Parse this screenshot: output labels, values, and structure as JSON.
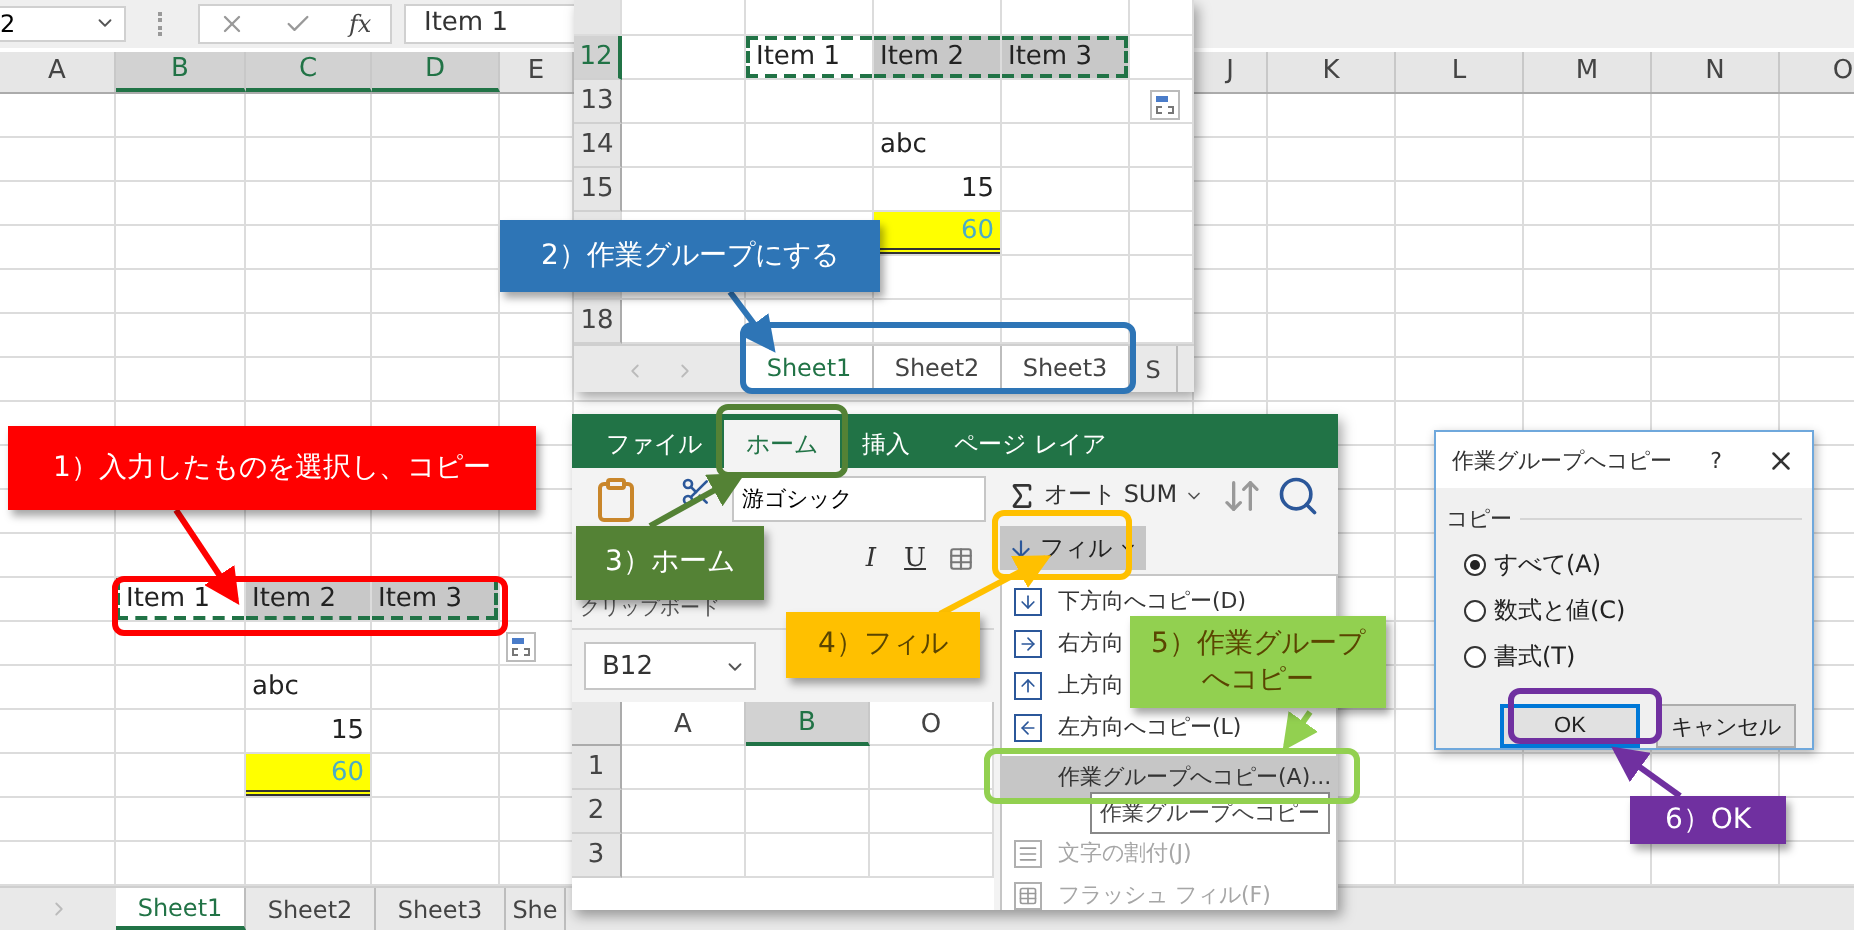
{
  "formula_bar": {
    "name_box": "2",
    "function_label": "fx",
    "formula": "Item 1"
  },
  "sheet": {
    "columns": [
      {
        "label": "A",
        "selected": false
      },
      {
        "label": "B",
        "selected": true
      },
      {
        "label": "C",
        "selected": true
      },
      {
        "label": "D",
        "selected": true
      },
      {
        "label": "E",
        "selected": false
      },
      {
        "label": "J",
        "selected": false
      },
      {
        "label": "K",
        "selected": false
      },
      {
        "label": "L",
        "selected": false
      },
      {
        "label": "M",
        "selected": false
      },
      {
        "label": "N",
        "selected": false
      },
      {
        "label": "O",
        "selected": false
      }
    ],
    "selection": [
      "Item 1",
      "Item 2",
      "Item 3"
    ],
    "values": [
      {
        "kind": "text",
        "text": "abc"
      },
      {
        "kind": "number",
        "text": "15"
      },
      {
        "kind": "highlight",
        "text": "60"
      }
    ],
    "tabs": [
      {
        "label": "Sheet1",
        "selected": true
      },
      {
        "label": "Sheet2",
        "selected": false
      },
      {
        "label": "Sheet3",
        "selected": false
      },
      {
        "label": "She",
        "selected": false
      }
    ]
  },
  "group_sheet": {
    "rows": [
      {
        "label": "12",
        "selected": true
      },
      {
        "label": "13",
        "selected": false
      },
      {
        "label": "14",
        "selected": false
      },
      {
        "label": "15",
        "selected": false
      },
      {
        "label": "18",
        "selected": false
      }
    ],
    "selection": [
      "Item 1",
      "Item 2",
      "Item 3"
    ],
    "values": [
      {
        "kind": "text",
        "text": "abc"
      },
      {
        "kind": "number",
        "text": "15"
      },
      {
        "kind": "highlight",
        "text": "60"
      }
    ],
    "tabs": [
      {
        "label": "Sheet1",
        "selected": true
      },
      {
        "label": "Sheet2",
        "selected": true
      },
      {
        "label": "Sheet3",
        "selected": true
      },
      {
        "label": "S",
        "selected": false
      }
    ]
  },
  "ribbon": {
    "tabs": [
      {
        "label": "ファイル",
        "selected": false
      },
      {
        "label": "ホーム",
        "selected": true
      },
      {
        "label": "挿入",
        "selected": false
      },
      {
        "label": "ページ レイア",
        "selected": false
      }
    ],
    "font": "游ゴシック",
    "format_buttons": [
      "I",
      "U"
    ],
    "clipboard_label": "クリップボード",
    "autosum": "オート SUM",
    "fill": {
      "label": "フィル",
      "expanded": true
    },
    "name_box": "B12",
    "columns": [
      {
        "label": "A",
        "selected": false
      },
      {
        "label": "B",
        "selected": true
      },
      {
        "label": "O",
        "selected": false
      }
    ],
    "rows": [
      "1",
      "2",
      "3"
    ]
  },
  "fill_menu": {
    "items": [
      {
        "kind": "down",
        "label": "下方向へコピー(D)",
        "disabled": false,
        "selected": false
      },
      {
        "kind": "right",
        "label": "右方向",
        "disabled": false,
        "selected": false
      },
      {
        "kind": "up",
        "label": "上方向",
        "disabled": false,
        "selected": false
      },
      {
        "kind": "left",
        "label": "左方向へコピー(L)",
        "disabled": false,
        "selected": false
      },
      {
        "kind": "plain",
        "label": "作業グループへコピー(A)...",
        "disabled": false,
        "selected": true
      },
      {
        "kind": "justify",
        "label": "文字の割付(J)",
        "disabled": true,
        "selected": false
      },
      {
        "kind": "flash",
        "label": "フラッシュ フィル(F)",
        "disabled": true,
        "selected": false
      }
    ],
    "tooltip": "作業グループへコピー"
  },
  "dialog": {
    "title": "作業グループへコピー",
    "help": "?",
    "group": "コピー",
    "options": [
      {
        "label": "すべて(A)",
        "selected": true
      },
      {
        "label": "数式と値(C)",
        "selected": false
      },
      {
        "label": "書式(T)",
        "selected": false
      }
    ],
    "buttons": [
      {
        "label": "OK",
        "kind": "default"
      },
      {
        "label": "キャンセル",
        "kind": "normal"
      }
    ]
  },
  "callouts": [
    {
      "text": "1）入力したものを選択し、コピー",
      "color": "#ff0000"
    },
    {
      "text": "2）作業グループにする",
      "color": "#2e75b6"
    },
    {
      "text": "3）ホーム",
      "color": "#548235"
    },
    {
      "text": "4）フィル",
      "color": "#ffc000"
    },
    {
      "text": "5）作業グループへコピー",
      "color": "#92d050"
    },
    {
      "text": "6）OK",
      "color": "#7030a0"
    }
  ]
}
